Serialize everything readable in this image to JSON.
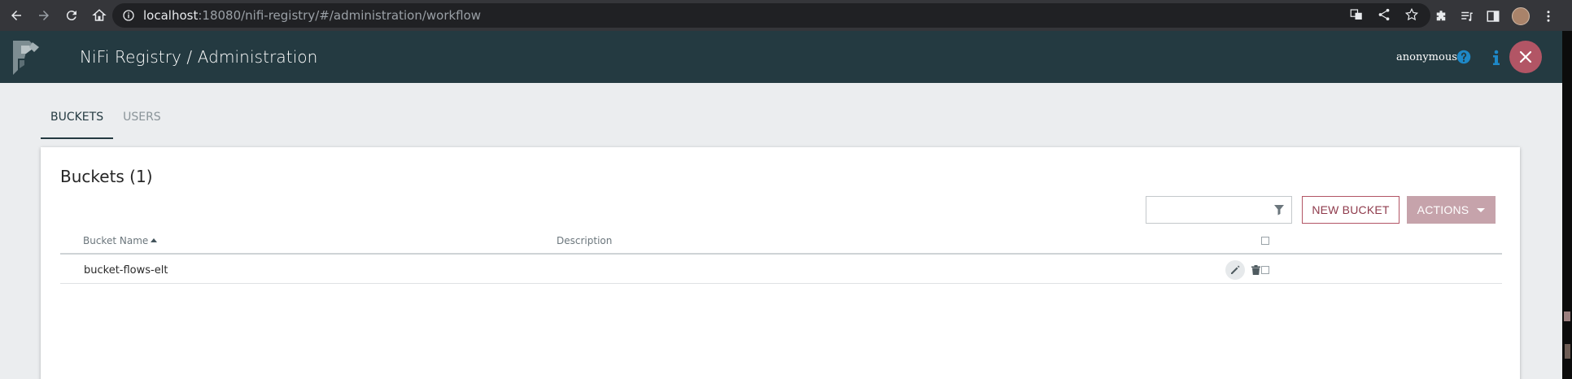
{
  "browser": {
    "url_host": "localhost",
    "url_rest": ":18080/nifi-registry/#/administration/workflow"
  },
  "header": {
    "title": "NiFi Registry / Administration",
    "user": "anonymous"
  },
  "tabs": [
    {
      "label": "BUCKETS",
      "active": true
    },
    {
      "label": "USERS",
      "active": false
    }
  ],
  "buckets": {
    "title": "Buckets (1)",
    "filter_value": "",
    "new_bucket_label": "NEW BUCKET",
    "actions_label": "ACTIONS",
    "columns": {
      "name": "Bucket Name",
      "description": "Description"
    },
    "rows": [
      {
        "name": "bucket-flows-elt",
        "description": ""
      }
    ]
  },
  "colors": {
    "header_bg": "#243a41",
    "accent": "#b25565",
    "page_bg": "#ebedef"
  }
}
